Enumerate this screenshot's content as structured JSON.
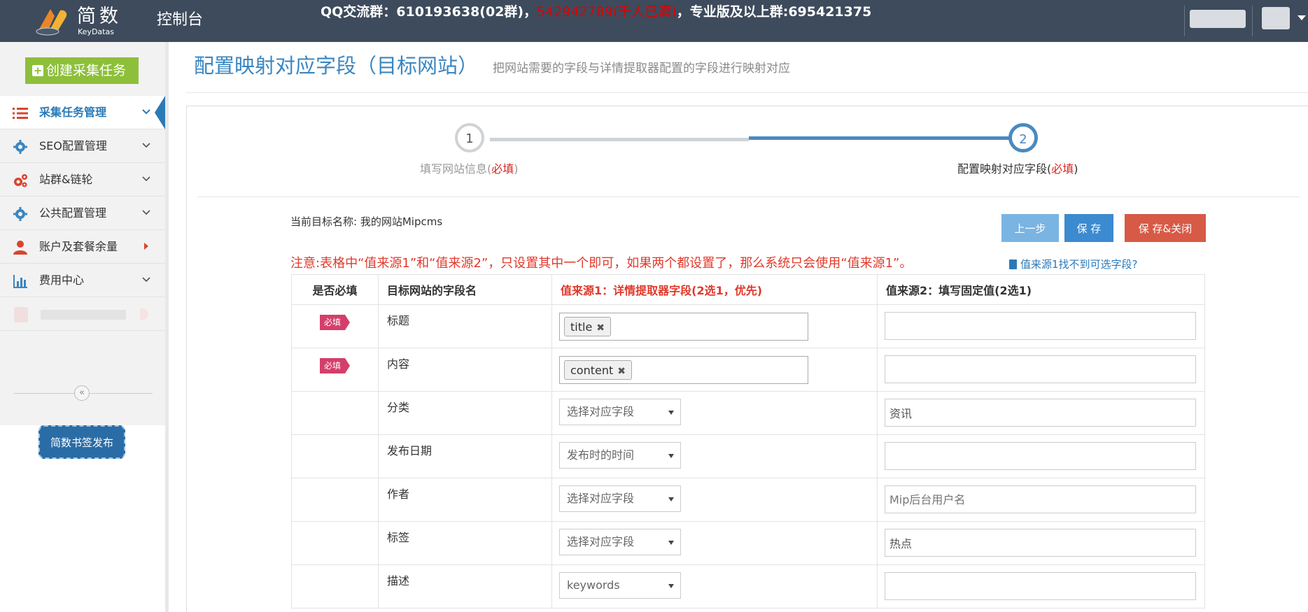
{
  "header": {
    "brand_cn": "简数",
    "brand_en": "KeyDatas",
    "console_label": "控制台",
    "notice_part1": "QQ交流群：610193638(02群)，",
    "notice_full_group": "542942789(千人已满)",
    "notice_part2": "，专业版及以上群:695421375"
  },
  "sidebar": {
    "create_task_label": "创建采集任务",
    "items": [
      {
        "label": "采集任务管理",
        "icon": "list-icon"
      },
      {
        "label": "SEO配置管理",
        "icon": "gear-icon"
      },
      {
        "label": "站群&链轮",
        "icon": "gears-icon"
      },
      {
        "label": "公共配置管理",
        "icon": "gear-icon"
      },
      {
        "label": "账户及套餐余量",
        "icon": "user-icon"
      },
      {
        "label": "费用中心",
        "icon": "bar-chart-icon"
      }
    ],
    "bookmark_label": "简数书签发布"
  },
  "page": {
    "title": "配置映射对应字段（目标网站）",
    "description": "把网站需要的字段与详情提取器配置的字段进行映射对应"
  },
  "steps": [
    {
      "number": "1",
      "label": "填写网站信息(",
      "required": "必填",
      "close": ")"
    },
    {
      "number": "2",
      "label": "配置映射对应字段(",
      "required": "必填",
      "close": ")"
    }
  ],
  "target": {
    "label": "当前目标名称:",
    "name": "我的网站Mipcms"
  },
  "buttons": {
    "prev": "上一步",
    "save": "保 存",
    "save_close": "保 存&关闭"
  },
  "warning": "注意:表格中“值来源1”和“值来源2”，只设置其中一个即可，如果两个都设置了，那么系统只会使用“值来源1”。",
  "help_link": "值来源1找不到可选字段?",
  "table": {
    "headers": [
      "是否必填",
      "目标网站的字段名",
      "值来源1：详情提取器字段(2选1，优先)",
      "值来源2：填写固定值(2选1)"
    ],
    "required_badge": "必填",
    "rows": [
      {
        "field": "标题",
        "required": true,
        "tag": "title",
        "fixed_value": ""
      },
      {
        "field": "内容",
        "required": true,
        "tag": "content",
        "fixed_value": ""
      },
      {
        "field": "分类",
        "required": false,
        "select": "选择对应字段",
        "fixed_value": "资讯"
      },
      {
        "field": "发布日期",
        "required": false,
        "select": "发布时的时间",
        "fixed_value": ""
      },
      {
        "field": "作者",
        "required": false,
        "select": "选择对应字段",
        "fixed_placeholder": "Mip后台用户名"
      },
      {
        "field": "标签",
        "required": false,
        "select": "选择对应字段",
        "fixed_value": "热点"
      },
      {
        "field": "描述",
        "required": false,
        "select": "keywords",
        "fixed_value": ""
      }
    ]
  },
  "colors": {
    "topbar": "#3d4b5c",
    "accent": "#3a86c1",
    "warning": "#e0392b",
    "create_button": "#8dbf3a",
    "required_badge": "#d43f6a"
  }
}
